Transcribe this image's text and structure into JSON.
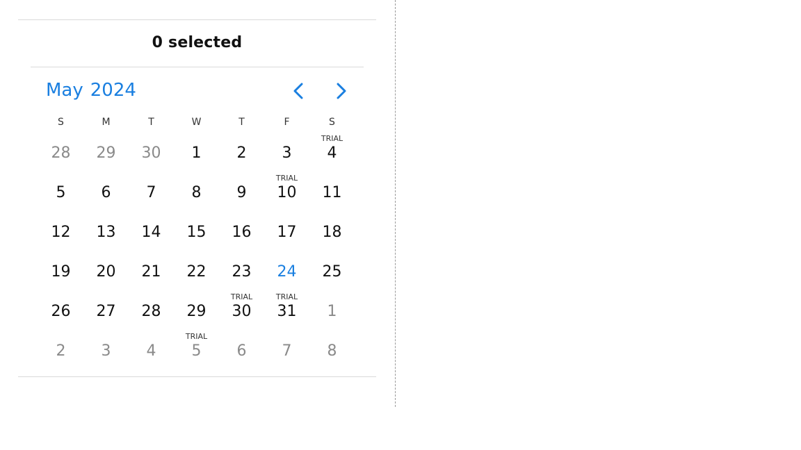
{
  "summary": {
    "text": "0 selected"
  },
  "calendar": {
    "month": "May",
    "year": "2024",
    "weekdays": [
      "S",
      "M",
      "T",
      "W",
      "T",
      "F",
      "S"
    ],
    "badge_label": "TRIAL",
    "colors": {
      "accent": "#1a7fe0",
      "muted": "#8a8a8a",
      "text": "#111111"
    },
    "weeks": [
      [
        {
          "d": "28",
          "other": true
        },
        {
          "d": "29",
          "other": true
        },
        {
          "d": "30",
          "other": true
        },
        {
          "d": "1"
        },
        {
          "d": "2"
        },
        {
          "d": "3"
        },
        {
          "d": "4",
          "badge": "TRIAL"
        }
      ],
      [
        {
          "d": "5"
        },
        {
          "d": "6"
        },
        {
          "d": "7"
        },
        {
          "d": "8"
        },
        {
          "d": "9"
        },
        {
          "d": "10",
          "badge": "TRIAL"
        },
        {
          "d": "11"
        }
      ],
      [
        {
          "d": "12"
        },
        {
          "d": "13"
        },
        {
          "d": "14"
        },
        {
          "d": "15"
        },
        {
          "d": "16"
        },
        {
          "d": "17"
        },
        {
          "d": "18"
        }
      ],
      [
        {
          "d": "19"
        },
        {
          "d": "20"
        },
        {
          "d": "21"
        },
        {
          "d": "22"
        },
        {
          "d": "23"
        },
        {
          "d": "24",
          "today": true
        },
        {
          "d": "25"
        }
      ],
      [
        {
          "d": "26"
        },
        {
          "d": "27"
        },
        {
          "d": "28"
        },
        {
          "d": "29"
        },
        {
          "d": "30",
          "badge": "TRIAL"
        },
        {
          "d": "31",
          "badge": "TRIAL"
        },
        {
          "d": "1",
          "other": true
        }
      ],
      [
        {
          "d": "2",
          "other": true
        },
        {
          "d": "3",
          "other": true
        },
        {
          "d": "4",
          "other": true
        },
        {
          "d": "5",
          "other": true,
          "badge": "TRIAL"
        },
        {
          "d": "6",
          "other": true
        },
        {
          "d": "7",
          "other": true
        },
        {
          "d": "8",
          "other": true
        }
      ]
    ]
  },
  "icons": {
    "prev": "chevron-left-icon",
    "next": "chevron-right-icon"
  }
}
